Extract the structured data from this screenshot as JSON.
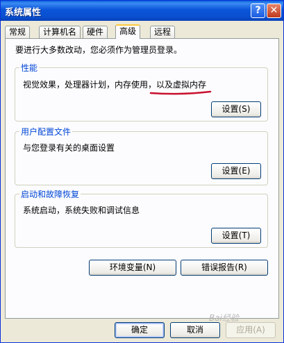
{
  "window": {
    "title": "系统属性",
    "help_label": "?",
    "close_label": "✕"
  },
  "tabs": [
    {
      "label": "常规"
    },
    {
      "label": "计算机名"
    },
    {
      "label": "硬件"
    },
    {
      "label": "高级",
      "active": true
    },
    {
      "label": "远程"
    }
  ],
  "advanced": {
    "intro": "要进行大多数改动，您必须作为管理员登录。",
    "performance": {
      "title": "性能",
      "description": "视觉效果，处理器计划，内存使用，以及虚拟内存",
      "button": "设置(S)"
    },
    "profiles": {
      "title": "用户配置文件",
      "description": "与您登录有关的桌面设置",
      "button": "设置(E)"
    },
    "startup": {
      "title": "启动和故障恢复",
      "description": "系统启动，系统失败和调试信息",
      "button": "设置(T)"
    },
    "env_button": "环境变量(N)",
    "error_button": "错误报告(R)"
  },
  "footer": {
    "ok": "确定",
    "cancel": "取消",
    "apply": "应用(A)"
  },
  "watermark": "Bai经验",
  "colors": {
    "titlebar": "#0a52d6",
    "annotation_underline": "#c8102e",
    "group_title": "#0046d5"
  }
}
